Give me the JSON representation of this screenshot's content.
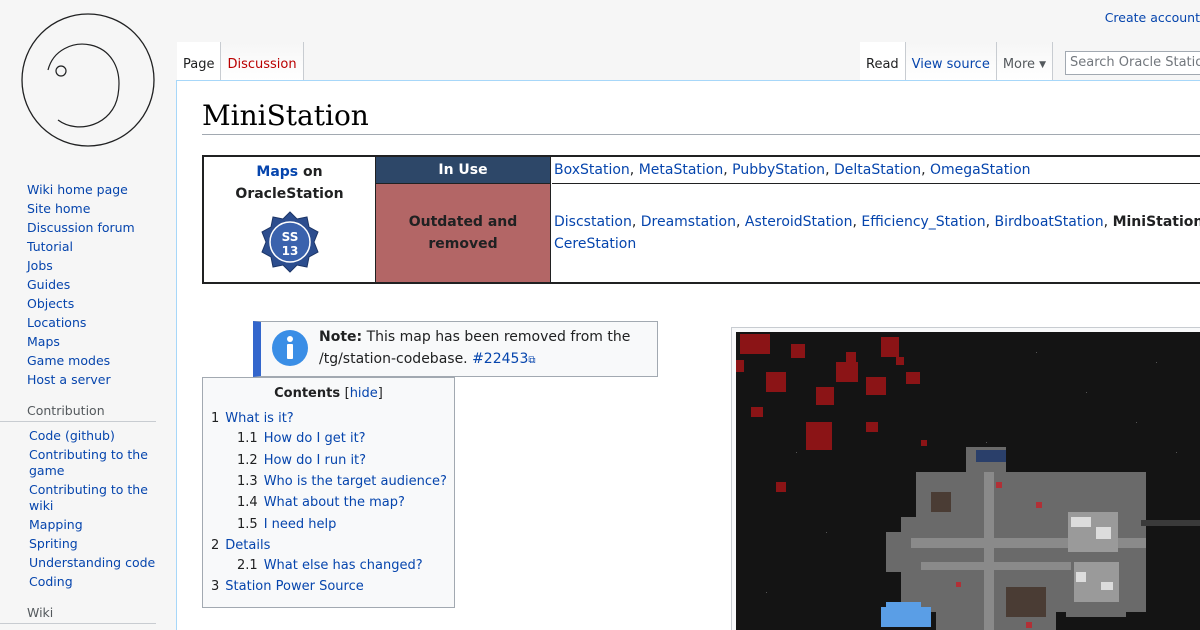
{
  "header": {
    "create_account": "Create account",
    "tabs_left": [
      "Page",
      "Discussion"
    ],
    "tabs_right": [
      "Read",
      "View source",
      "More"
    ],
    "search_placeholder": "Search Oracle Station"
  },
  "sidebar": {
    "nav": [
      "Wiki home page",
      "Site home",
      "Discussion forum",
      "Tutorial",
      "Jobs",
      "Guides",
      "Objects",
      "Locations",
      "Maps",
      "Game modes",
      "Host a server"
    ],
    "contribution_heading": "Contribution",
    "contribution": [
      "Code (github)",
      "Contributing to the game",
      "Contributing to the wiki",
      "Mapping",
      "Spriting",
      "Understanding code",
      "Coding"
    ],
    "wiki_heading": "Wiki"
  },
  "page": {
    "title": "MiniStation",
    "maps_box": {
      "maps_link": "Maps",
      "on_text": " on",
      "site": "OracleStation",
      "logo_text": "SS13",
      "in_use_label": "In Use",
      "in_use": [
        "BoxStation",
        "MetaStation",
        "PubbyStation",
        "DeltaStation",
        "OmegaStation"
      ],
      "outdated_label": "Outdated and removed",
      "outdated": [
        "Discstation",
        "Dreamstation",
        "AsteroidStation",
        "Efficiency_Station",
        "BirdboatStation"
      ],
      "current": "MiniStation",
      "outdated_after": "CereStation"
    },
    "note": {
      "label": "Note:",
      "text": " This map has been removed from the /tg/station-codebase. ",
      "link": "#22453"
    },
    "toc": {
      "title": "Contents",
      "toggle": "hide",
      "items": [
        {
          "num": "1",
          "text": "What is it?",
          "level": 1
        },
        {
          "num": "1.1",
          "text": "How do I get it?",
          "level": 2
        },
        {
          "num": "1.2",
          "text": "How do I run it?",
          "level": 2
        },
        {
          "num": "1.3",
          "text": "Who is the target audience?",
          "level": 2
        },
        {
          "num": "1.4",
          "text": "What about the map?",
          "level": 2
        },
        {
          "num": "1.5",
          "text": "I need help",
          "level": 2
        },
        {
          "num": "2",
          "text": "Details",
          "level": 1
        },
        {
          "num": "2.1",
          "text": "What else has changed?",
          "level": 2
        },
        {
          "num": "3",
          "text": "Station Power Source",
          "level": 1
        }
      ]
    }
  },
  "colors": {
    "link": "#0645ad",
    "in_use_bg": "#2d4768",
    "outdated_bg": "#b36666",
    "note_accent": "#3366cc"
  }
}
